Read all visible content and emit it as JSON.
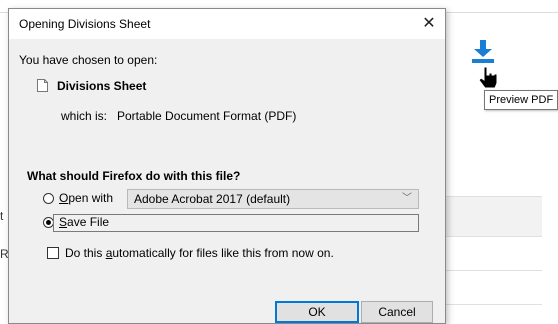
{
  "dialog": {
    "title": "Opening Divisions Sheet",
    "chosen_text": "You have chosen to open:",
    "filename": "Divisions Sheet",
    "which_is_label": "which is:",
    "file_type": "Portable Document Format (PDF)",
    "question": "What should Firefox do with this file?",
    "open_with": {
      "accel": "O",
      "rest": "pen with",
      "selected_app": "Adobe Acrobat 2017 (default)",
      "checked": false
    },
    "save_file": {
      "accel": "S",
      "rest": "ave File",
      "checked": true
    },
    "auto": {
      "before": "Do this ",
      "accel": "a",
      "after": "utomatically for files like this from now on.",
      "checked": false
    },
    "ok_label": "OK",
    "cancel_label": "Cancel"
  },
  "background": {
    "tooltip": "Preview PDF",
    "left_fragments": [
      "t",
      "R"
    ]
  },
  "colors": {
    "download_icon": "#1a7fd4",
    "dialog_bg": "#f0f0f0",
    "ok_border": "#0078d7"
  },
  "icons": {
    "download": "download-icon",
    "cursor": "hand-cursor-icon",
    "file": "file-icon",
    "close": "close-icon"
  }
}
